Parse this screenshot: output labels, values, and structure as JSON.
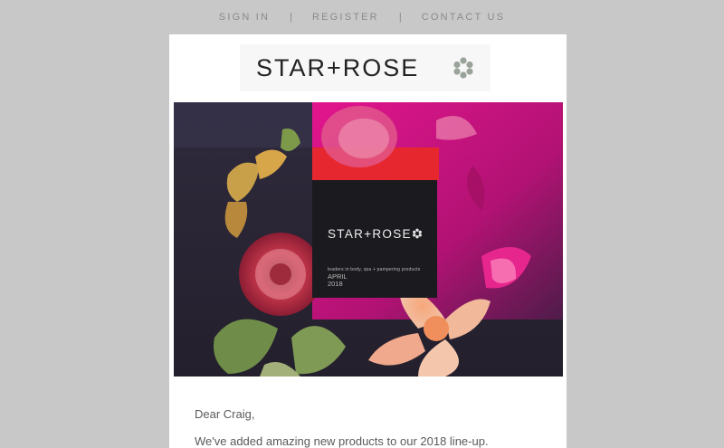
{
  "nav": {
    "sign_in": "SIGN IN",
    "register": "REGISTER",
    "contact": "CONTACT US",
    "separator": "|"
  },
  "logo": {
    "text": "STAR+ROSE",
    "icon": "flower-icon"
  },
  "hero": {
    "brand": "STAR+ROSE",
    "tagline": "leaders in body, spa + pampering products",
    "month": "APRIL",
    "year": "2018"
  },
  "body": {
    "greeting": "Dear Craig,",
    "intro": "We've added amazing new products to our 2018 line-up."
  },
  "colors": {
    "page_bg": "#c8c8c8",
    "card_bg": "#ffffff",
    "nav_text": "#8a8a8a",
    "hero_magenta": "#d6178a",
    "hero_dark": "#2a2636"
  }
}
